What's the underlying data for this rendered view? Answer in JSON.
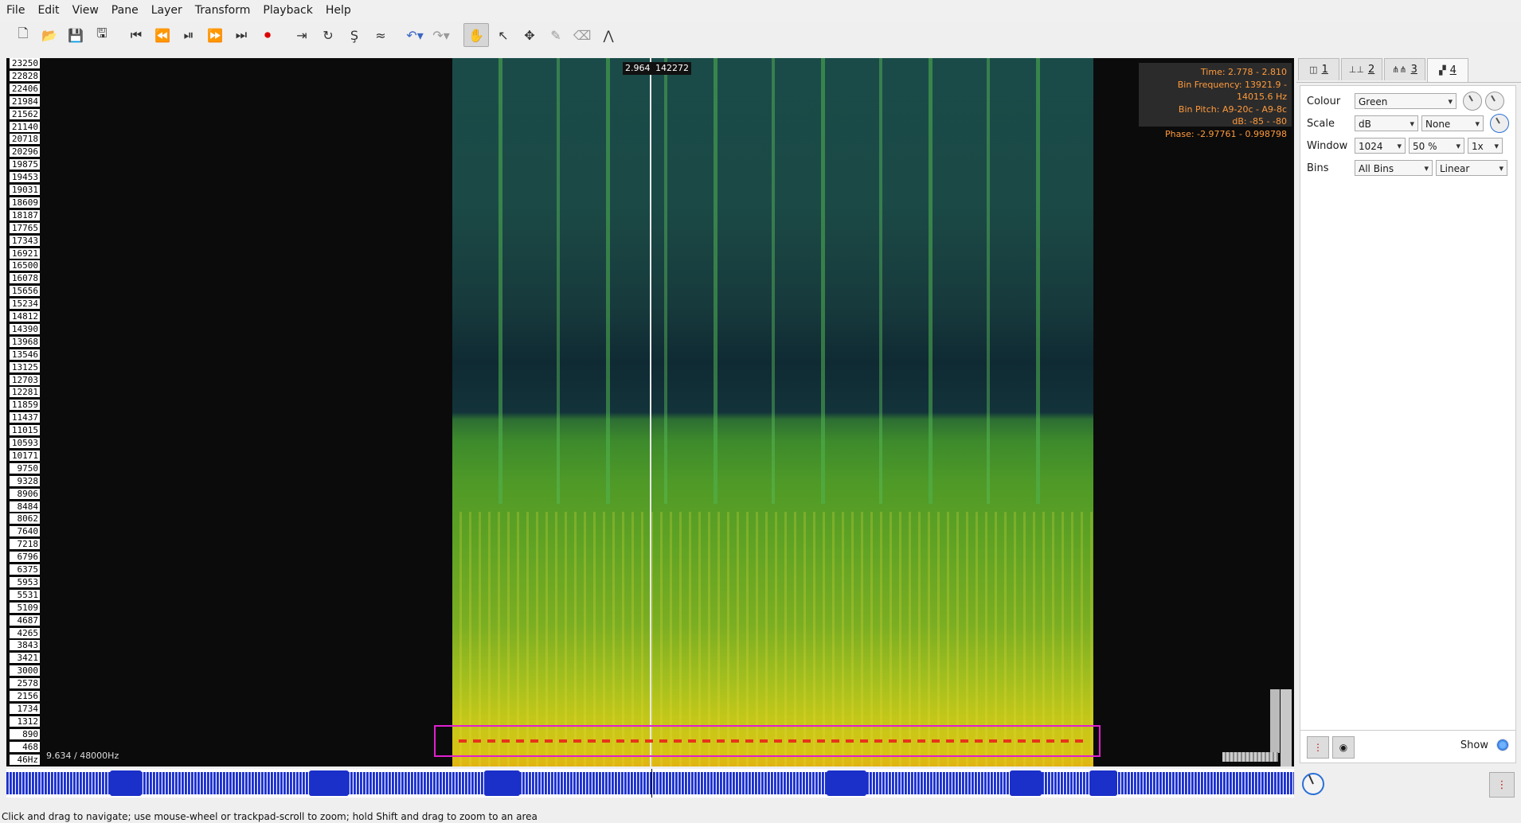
{
  "menu": [
    "File",
    "Edit",
    "View",
    "Pane",
    "Layer",
    "Transform",
    "Playback",
    "Help"
  ],
  "toolbar": {
    "icons": [
      "new-file-icon",
      "open-file-icon",
      "save-icon",
      "save-as-icon",
      "rewind-start-icon",
      "rewind-icon",
      "play-pause-icon",
      "fast-forward-icon",
      "ffwd-end-icon",
      "record-icon",
      "play-selection-icon",
      "loop-icon",
      "solo-icon",
      "speedup-icon",
      "undo-icon",
      "redo-icon",
      "navigate-icon",
      "select-icon",
      "move-icon",
      "draw-icon",
      "erase-icon",
      "measure-icon"
    ]
  },
  "ruler": {
    "ticks": [
      "23250",
      "22828",
      "22406",
      "21984",
      "21562",
      "21140",
      "20718",
      "20296",
      "19875",
      "19453",
      "19031",
      "18609",
      "18187",
      "17765",
      "17343",
      "16921",
      "16500",
      "16078",
      "15656",
      "15234",
      "14812",
      "14390",
      "13968",
      "13546",
      "13125",
      "12703",
      "12281",
      "11859",
      "11437",
      "11015",
      "10593",
      "10171",
      "9750",
      "9328",
      "8906",
      "8484",
      "8062",
      "7640",
      "7218",
      "6796",
      "6375",
      "5953",
      "5531",
      "5109",
      "4687",
      "4265",
      "3843",
      "3421",
      "3000",
      "2578",
      "2156",
      "1734",
      "1312",
      "890",
      "468",
      "46Hz"
    ]
  },
  "cursor": {
    "time_label": "2.964",
    "frame_label": "142272"
  },
  "info": {
    "time": "Time: 2.778 - 2.810",
    "bin_frequency": "Bin Frequency: 13921.9 - 14015.6 Hz",
    "bin_pitch": "Bin Pitch: A9-20c - A9-8c",
    "db": "dB: -85 - -80",
    "phase": "Phase: -2.97761 - 0.998798"
  },
  "pane_status": "9.634 / 48000Hz",
  "status_bar": "Click and drag to navigate; use mouse-wheel or trackpad-scroll to zoom; hold Shift and drag to zoom to an area",
  "tabs": [
    {
      "label": "1",
      "icon": "pane-icon"
    },
    {
      "label": "2",
      "icon": "ruler-icon"
    },
    {
      "label": "3",
      "icon": "waveform-icon"
    },
    {
      "label": "4",
      "icon": "spectrogram-icon"
    }
  ],
  "properties": {
    "colour_label": "Colour",
    "colour_value": "Green",
    "scale_label": "Scale",
    "scale_value": "dB",
    "scale_norm": "None",
    "window_label": "Window",
    "window_size": "1024",
    "window_overlap": "50 %",
    "window_oversample": "1x",
    "bins_label": "Bins",
    "bins_value": "All Bins",
    "bins_scale": "Linear"
  },
  "show_label": "Show"
}
